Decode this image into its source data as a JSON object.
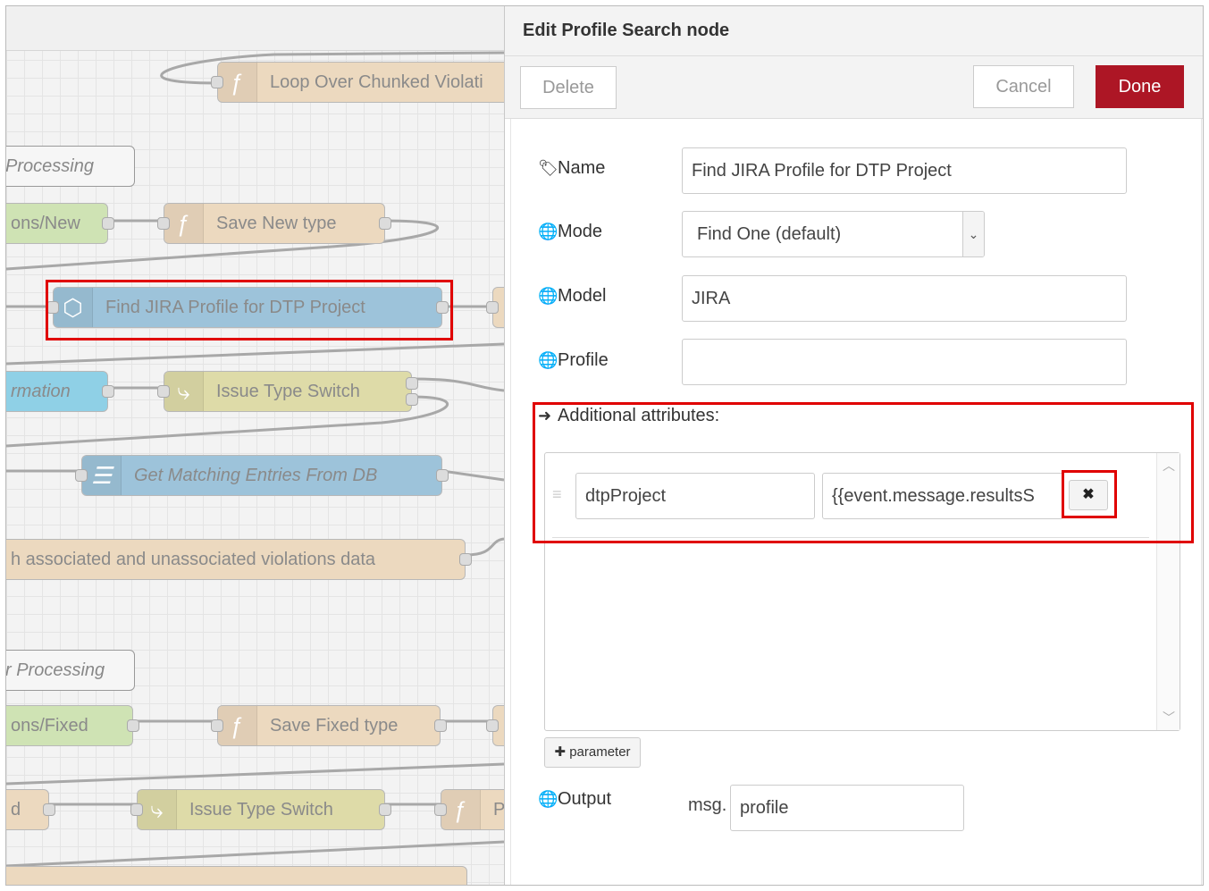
{
  "canvas": {
    "nodes": {
      "loop": "Loop Over Chunked Violati",
      "processing1": "Processing",
      "violations_new": "ons/New",
      "save_new": "Save New type",
      "find_jira": "Find JIRA Profile for DTP Project",
      "information": "rmation",
      "issue_type_switch1": "Issue Type Switch",
      "get_matching": "Get Matching Entries From DB",
      "associated": "h associated and unassociated violations data",
      "processing2": "r Processing",
      "violations_fixed": "ons/Fixed",
      "save_fixed": "Save Fixed type",
      "d_node": "d",
      "issue_type_switch2": "Issue Type Switch",
      "p_node": "P"
    }
  },
  "tray": {
    "title": "Edit Profile Search node",
    "delete_label": "Delete",
    "cancel_label": "Cancel",
    "done_label": "Done",
    "name_label": "Name",
    "name_value": "Find JIRA Profile for DTP Project",
    "mode_label": "Mode",
    "mode_value": "Find One (default)",
    "model_label": "Model",
    "model_value": "JIRA",
    "profile_label": "Profile",
    "profile_value": "",
    "additional_label": "Additional attributes:",
    "attributes": [
      {
        "key": "dtpProject",
        "value": "{{event.message.resultsS"
      }
    ],
    "add_param_label": "parameter",
    "output_label": "Output",
    "output_prefix": "msg.",
    "output_value": "profile"
  },
  "colors": {
    "done_button": "#ad1625",
    "highlight": "#e00000"
  }
}
